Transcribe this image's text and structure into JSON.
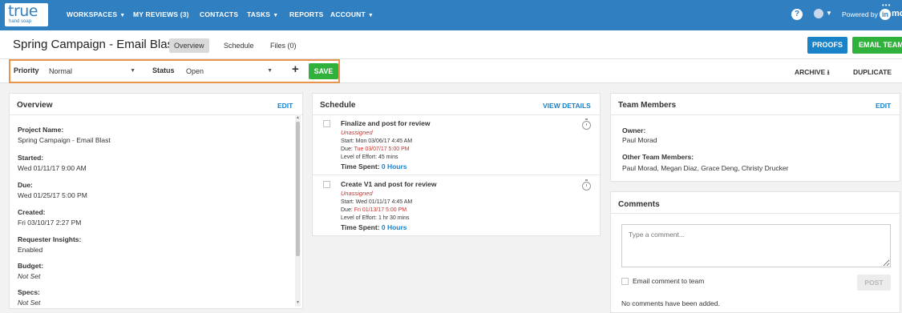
{
  "nav": {
    "logo_main": "true",
    "logo_sub": "hand soap",
    "items": [
      {
        "label": "WORKSPACES",
        "caret": true
      },
      {
        "label": "MY REVIEWS (3)",
        "caret": false
      },
      {
        "label": "CONTACTS",
        "caret": false
      },
      {
        "label": "TASKS",
        "caret": true
      },
      {
        "label": "REPORTS",
        "caret": false
      },
      {
        "label": "ACCOUNT",
        "caret": true
      }
    ],
    "help": "?",
    "powered_by": "Powered by",
    "brand_mark": "in",
    "brand_text": "moti"
  },
  "header": {
    "title": "Spring Campaign - Email Blast",
    "tabs": [
      "Overview",
      "Schedule",
      "Files (0)"
    ],
    "active_tab": "Overview",
    "proofs_button": "PROOFS",
    "email_team_button": "EMAIL TEAM"
  },
  "controls": {
    "priority_label": "Priority",
    "priority_value": "Normal",
    "status_label": "Status",
    "status_value": "Open",
    "plus": "+",
    "save": "SAVE",
    "archive": "ARCHIVE",
    "duplicate": "DUPLICATE"
  },
  "overview": {
    "title": "Overview",
    "edit": "EDIT",
    "fields": [
      {
        "label": "Project Name:",
        "value": "Spring Campaign - Email Blast",
        "italic": false
      },
      {
        "label": "Started:",
        "value": "Wed 01/11/17 9:00 AM",
        "italic": false
      },
      {
        "label": "Due:",
        "value": "Wed 01/25/17 5:00 PM",
        "italic": false
      },
      {
        "label": "Created:",
        "value": "Fri 03/10/17 2:27 PM",
        "italic": false
      },
      {
        "label": "Requester Insights:",
        "value": "Enabled",
        "italic": false
      },
      {
        "label": "Budget:",
        "value": "Not Set",
        "italic": true
      },
      {
        "label": "Specs:",
        "value": "Not Set",
        "italic": true
      }
    ]
  },
  "schedule": {
    "title": "Schedule",
    "view_details": "VIEW DETAILS",
    "tasks": [
      {
        "name": "Finalize and post for review",
        "assignee": "Unassigned",
        "start": "Start: Mon 03/06/17 4:45 AM",
        "due_label": "Due: ",
        "due_value": "Tue 03/07/17 5:00 PM",
        "effort": "Level of Effort: 45 mins",
        "spent_label": "Time Spent: ",
        "spent_value": "0 Hours"
      },
      {
        "name": "Create V1 and post for review",
        "assignee": "Unassigned",
        "start": "Start: Wed 01/11/17 4:45 AM",
        "due_label": "Due: ",
        "due_value": "Fri 01/13/17 5:00 PM",
        "effort": "Level of Effort: 1 hr 30 mins",
        "spent_label": "Time Spent: ",
        "spent_value": "0 Hours"
      }
    ]
  },
  "team": {
    "title": "Team Members",
    "edit": "EDIT",
    "owner_label": "Owner:",
    "owner": "Paul Morad",
    "others_label": "Other Team Members:",
    "others": "Paul Morad, Megan Diaz, Grace Deng, Christy Drucker"
  },
  "comments": {
    "title": "Comments",
    "placeholder": "Type a comment...",
    "email_label": "Email comment to team",
    "post": "POST",
    "empty": "No comments have been added."
  },
  "colors": {
    "nav_bg": "#2f7fc1",
    "accent_blue": "#1a82c7",
    "accent_green": "#2fb13b",
    "due_red": "#c9302c",
    "highlight_orange": "#e8944d"
  }
}
